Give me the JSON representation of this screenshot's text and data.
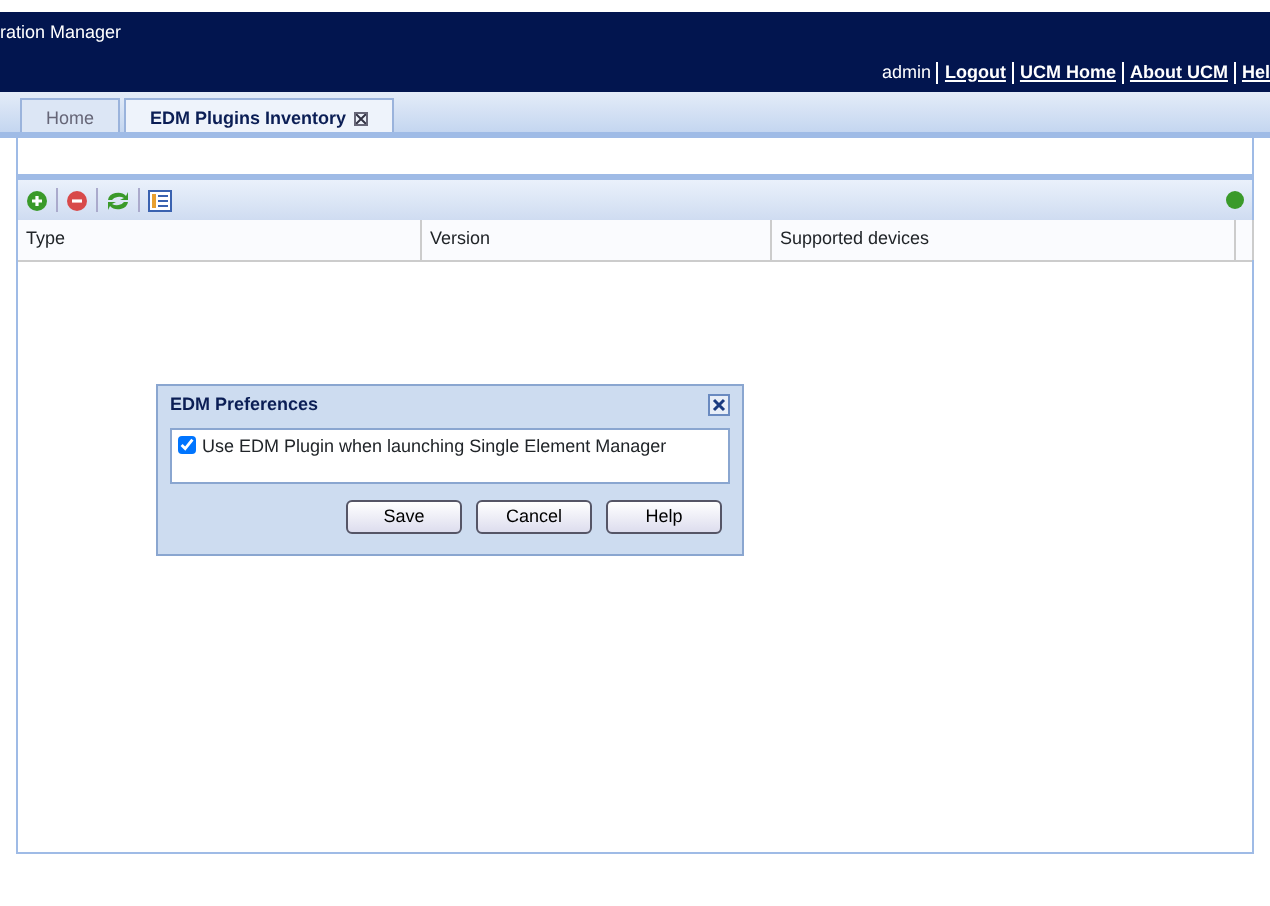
{
  "header": {
    "title": "ration Manager",
    "user": "admin",
    "links": [
      "Logout",
      "UCM Home",
      "About UCM",
      "Hel"
    ]
  },
  "tabs": [
    {
      "label": "Home",
      "selected": false,
      "closable": false
    },
    {
      "label": "EDM Plugins Inventory",
      "selected": true,
      "closable": true
    }
  ],
  "toolbar": {
    "buttons": [
      {
        "kind": "add"
      },
      {
        "kind": "remove"
      },
      {
        "kind": "refresh"
      },
      {
        "kind": "preferences"
      }
    ]
  },
  "table": {
    "columns": [
      "Type",
      "Version",
      "Supported devices"
    ]
  },
  "dialog": {
    "title": "EDM Preferences",
    "option": {
      "label": "Use EDM Plugin when launching Single Element Manager",
      "checked": true
    },
    "buttons": [
      "Save",
      "Cancel",
      "Help"
    ]
  }
}
